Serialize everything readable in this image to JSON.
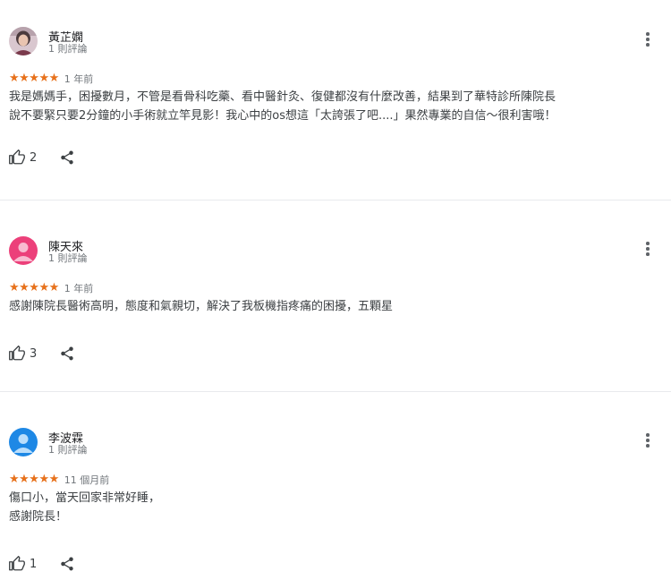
{
  "reviews": [
    {
      "name": "黃芷嫻",
      "count": "1 則評論",
      "stars": "★★★★★",
      "time": "1 年前",
      "text": "我是媽媽手，困擾數月，不管是看骨科吃藥、看中醫針灸、復健都沒有什麼改善，結果到了華特診所陳院長\n說不要緊只要2分鐘的小手術就立竿見影！我心中的os想這「太誇張了吧....」果然專業的自信～很利害哦！",
      "likes": "2",
      "avatar": "photo"
    },
    {
      "name": "陳天來",
      "count": "1 則評論",
      "stars": "★★★★★",
      "time": "1 年前",
      "text": "感謝陳院長醫術高明，態度和氣親切，解決了我板機指疼痛的困擾，五顆星",
      "likes": "3",
      "avatar": "#ec407a"
    },
    {
      "name": "李波霖",
      "count": "1 則評論",
      "stars": "★★★★★",
      "time": "11 個月前",
      "text": "傷口小，當天回家非常好睡，\n感謝院長！",
      "likes": "1",
      "avatar": "#1e88e5"
    }
  ]
}
